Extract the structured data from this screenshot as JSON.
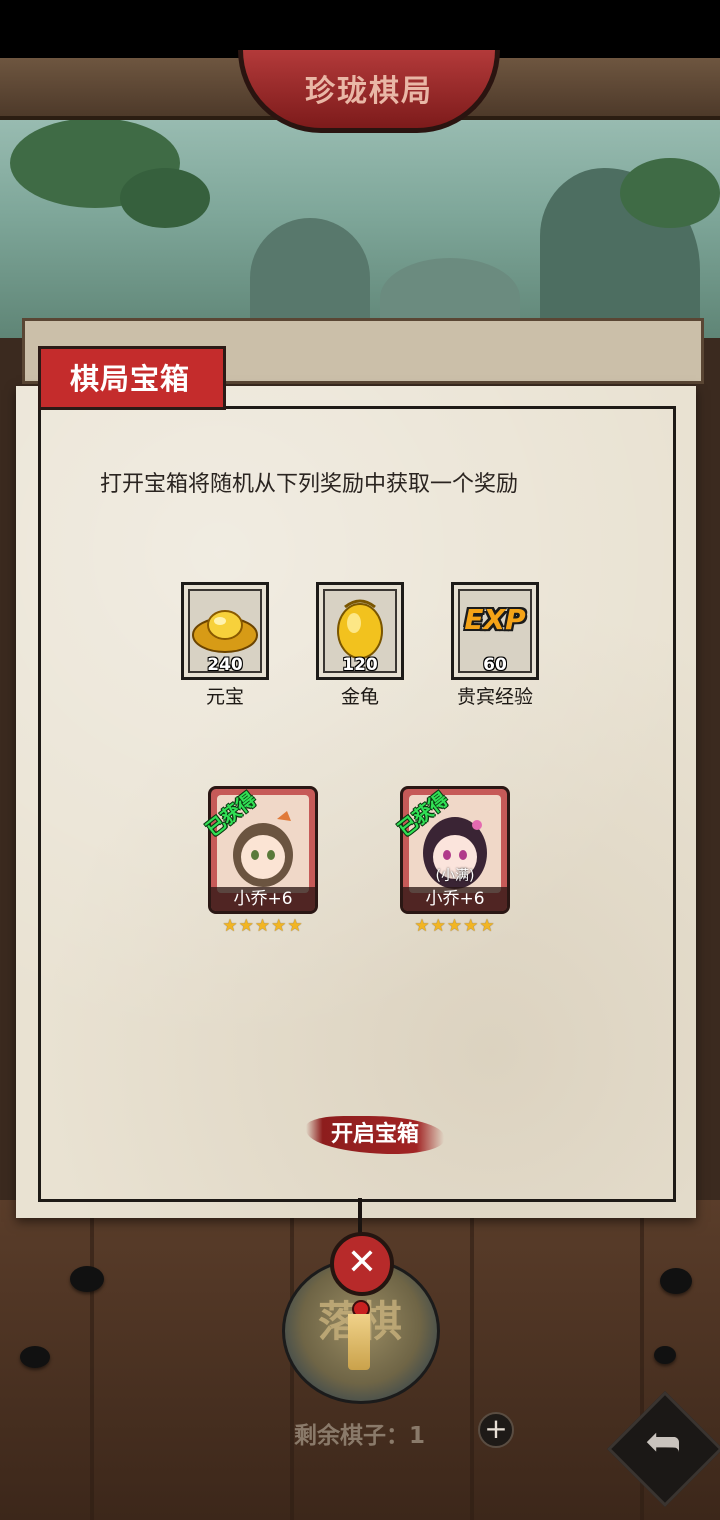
{
  "header": {
    "title": "珍珑棋局"
  },
  "dialog": {
    "title": "棋局宝箱",
    "description": "打开宝箱将随机从下列奖励中获取一个奖励",
    "rewards": [
      {
        "icon": "gold-ingot-icon",
        "count": "240",
        "name": "元宝"
      },
      {
        "icon": "golden-turtle-icon",
        "count": "120",
        "name": "金龟"
      },
      {
        "icon": "exp-icon",
        "icon_text": "EXP",
        "count": "60",
        "name": "贵宾经验"
      }
    ],
    "characters": [
      {
        "status": "已获得",
        "name": "小乔+6",
        "stars": "★★★★★"
      },
      {
        "status": "已获得",
        "tag": "(小满)",
        "name": "小乔+6",
        "stars": "★★★★★"
      }
    ],
    "open_button": "开启宝箱",
    "close_icon": "close-icon"
  },
  "bottom": {
    "drop_label": "落棋",
    "remaining": "剩余棋子：1",
    "add_icon": "+",
    "share_icon": "share-arrow-icon"
  },
  "colors": {
    "accent_red": "#c42c2c",
    "paper": "#e9e2d2",
    "obtained_green": "#31e055",
    "star_gold": "#f2b523"
  }
}
